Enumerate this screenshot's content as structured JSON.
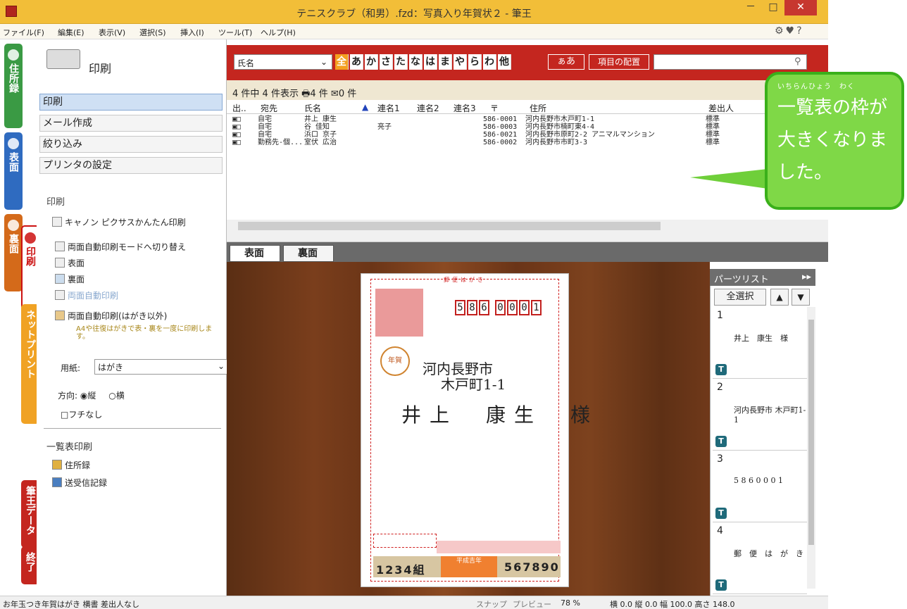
{
  "window": {
    "title": "テニスクラブ（和男）.fzd：写真入り年賀状２ - 筆王",
    "min": "－",
    "max": "□",
    "close": "✕"
  },
  "menu": [
    "ファイル(F)",
    "編集(E)",
    "表示(V)",
    "選択(S)",
    "挿入(I)",
    "ツール(T)",
    "ヘルプ(H)"
  ],
  "side_tabs": {
    "address": "住所録",
    "omote": "表面",
    "ura": "裏面",
    "print": "印刷",
    "netprint": "ネットプリント",
    "data": "筆王データ",
    "exit": "終了"
  },
  "panel": {
    "title": "印刷",
    "nav": [
      "印刷",
      "メール作成",
      "絞り込み",
      "プリンタの設定"
    ],
    "print_section": "印刷",
    "canon": "キャノン ピクサスかんたん印刷",
    "duplex_mode": "両面自動印刷モードへ切り替え",
    "front": "表面",
    "back": "裏面",
    "duplex": "両面自動印刷",
    "duplex_non_postcard": "両面自動印刷(はがき以外)",
    "hint": "A4や往復はがきで表・裏を一度に印刷します。",
    "paper_label": "用紙:",
    "paper_value": "はがき",
    "orientation_label": "方向:",
    "orient_portrait": "縦",
    "orient_landscape": "横",
    "borderless": "フチなし",
    "list_print": "一覧表印刷",
    "address_book": "住所録",
    "send_receive": "送受信記録"
  },
  "search": {
    "field": "氏名",
    "kana": [
      "全",
      "あ",
      "か",
      "さ",
      "た",
      "な",
      "は",
      "ま",
      "や",
      "ら",
      "わ",
      "他"
    ],
    "kana_selected": "全",
    "kana_toggle": "ぁあ",
    "layout_button": "項目の配置",
    "query": ""
  },
  "list": {
    "count_text": "4 件中 4 件表示",
    "print_count": "4 件",
    "mail_count": "0 件",
    "columns": [
      "出..",
      "宛先",
      "氏名",
      "連名1",
      "連名2",
      "連名3",
      "〒",
      "住所",
      "差出人"
    ],
    "rows": [
      {
        "dest": "自宅",
        "name": "井上 康生",
        "ren1": "",
        "zip": "586-0001",
        "addr": "河内長野市木戸町1-1",
        "sender": "標準"
      },
      {
        "dest": "自宅",
        "name": "谷 佳知",
        "ren1": "亮子",
        "zip": "586-0003",
        "addr": "河内長野市楠町東4-4",
        "sender": "標準"
      },
      {
        "dest": "自宅",
        "name": "浜口 京子",
        "ren1": "",
        "zip": "586-0021",
        "addr": "河内長野市原町2-2 アニマルマンション",
        "sender": "標準"
      },
      {
        "dest": "勤務先-個...",
        "name": "室伏 広治",
        "ren1": "",
        "zip": "586-0002",
        "addr": "河内長野市市町3-3",
        "sender": "標準"
      }
    ]
  },
  "preview": {
    "tabs": [
      "表面",
      "裏面"
    ],
    "card_header": "郵便はがき",
    "zip_digits": [
      "5",
      "8",
      "6",
      "0",
      "0",
      "0",
      "1"
    ],
    "postmark": "年賀",
    "addr1": "河内長野市",
    "addr2": "木戸町1-1",
    "recipient": "井上　康生　様",
    "lottery_left": "1234組",
    "lottery_right": "567890",
    "lottery_center": "平成吉年"
  },
  "parts": {
    "title": "パーツリスト",
    "select_all": "全選択",
    "items": [
      {
        "num": "1",
        "content": "井上　康生　様"
      },
      {
        "num": "2",
        "content": "河内長野市 木戸町1-1"
      },
      {
        "num": "3",
        "content": "5 8 6 0 0 0 1"
      },
      {
        "num": "4",
        "content": "郵　便　は　が　き"
      }
    ]
  },
  "status": {
    "left": "お年玉つき年賀はがき 横書 差出人なし",
    "snap": "スナップ",
    "preview": "プレビュー",
    "zoom": "78 %",
    "coords": "横 0.0 縦 0.0 幅 100.0 高さ 148.0"
  },
  "callout": {
    "ruby": "いちらんひょう　わく",
    "text": "一覧表の枠が大きくなりました。"
  }
}
